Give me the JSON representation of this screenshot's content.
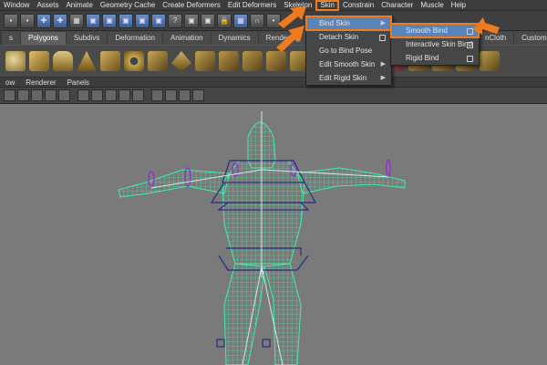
{
  "menubar": {
    "items": [
      "Window",
      "Assets",
      "Animate",
      "Geometry Cache",
      "Create Deformers",
      "Edit Deformers",
      "Skeleton",
      "Skin",
      "Constrain",
      "Character",
      "Muscle",
      "Help"
    ],
    "active": "Skin"
  },
  "shelf_tabs": {
    "items": [
      "s",
      "Polygons",
      "Subdivs",
      "Deformation",
      "Animation",
      "Dynamics",
      "Rendering",
      "P",
      "nCloth",
      "Custom"
    ],
    "active": "Polygons"
  },
  "panel_menu": {
    "items": [
      "ow",
      "Renderer",
      "Panels"
    ]
  },
  "skin_menu": {
    "items": [
      {
        "label": "Bind Skin",
        "submenu": true,
        "highlighted": true
      },
      {
        "label": "Detach Skin",
        "option_box": true
      },
      {
        "label": "Go to Bind Pose"
      },
      {
        "label": "Edit Smooth Skin",
        "submenu": true
      },
      {
        "label": "Edit Rigid Skin",
        "submenu": true
      }
    ]
  },
  "bind_skin_submenu": {
    "items": [
      {
        "label": "Smooth Bind",
        "option_box": true,
        "highlighted": true
      },
      {
        "label": "Interactive Skin Bind",
        "option_box": true
      },
      {
        "label": "Rigid Bind",
        "option_box": true
      }
    ]
  },
  "colors": {
    "highlight_outline": "#f07a1e",
    "menu_highlight": "#5a84b8",
    "wireframe": "#3df0a8",
    "joint": "#9933cc",
    "viewport_bg": "#7a7a7a"
  }
}
